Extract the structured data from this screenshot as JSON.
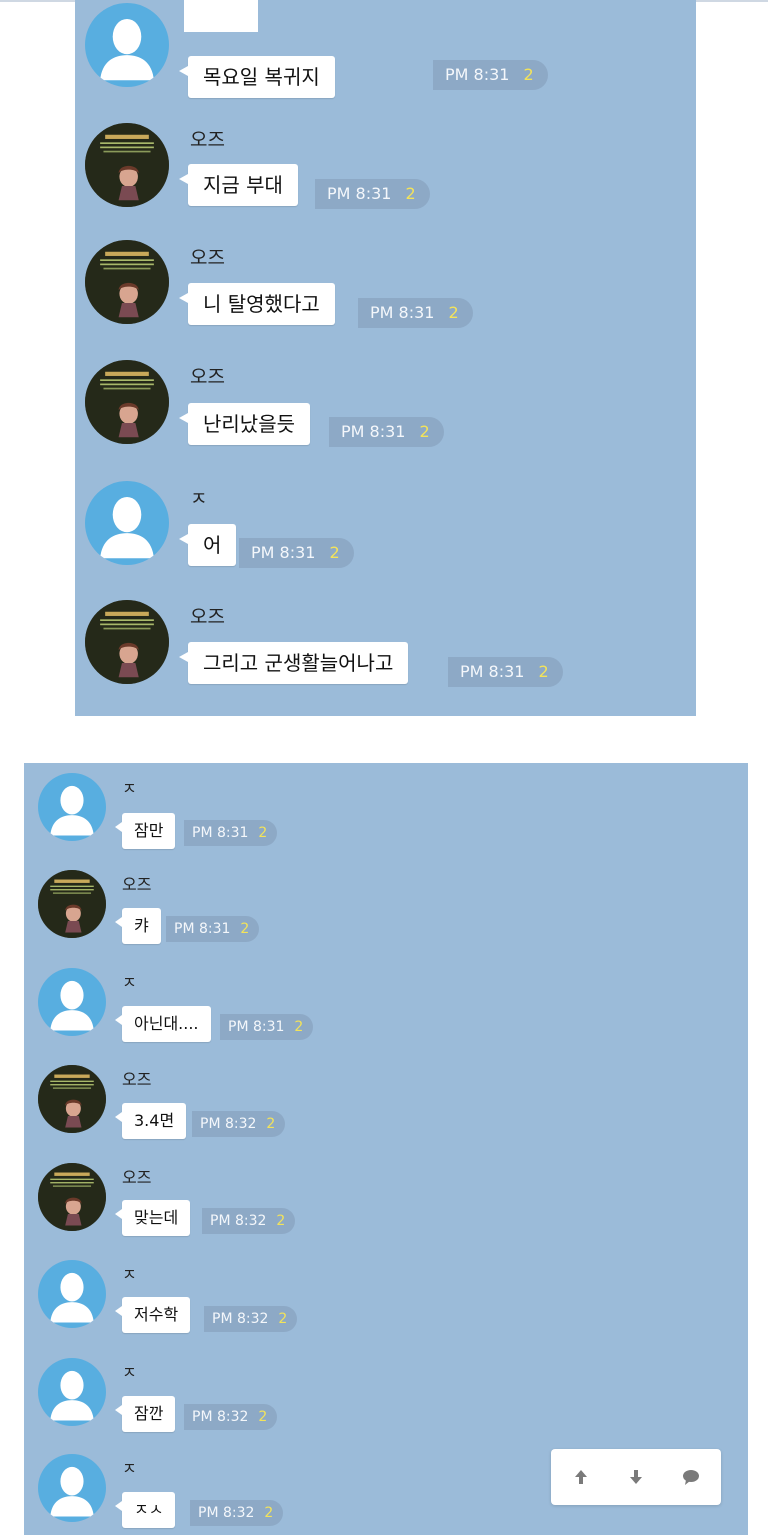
{
  "top_chat": {
    "messages": [
      {
        "avatar": "default-profile",
        "sender": "",
        "text": "목요일 복귀지",
        "time": "PM 8:31",
        "count": "2"
      },
      {
        "avatar": "oz-profile",
        "sender": "오즈",
        "text": "지금 부대",
        "time": "PM 8:31",
        "count": "2"
      },
      {
        "avatar": "oz-profile",
        "sender": "오즈",
        "text": "니 탈영했다고",
        "time": "PM 8:31",
        "count": "2"
      },
      {
        "avatar": "oz-profile",
        "sender": "오즈",
        "text": "난리났을듯",
        "time": "PM 8:31",
        "count": "2"
      },
      {
        "avatar": "default-profile",
        "sender": "ㅈ",
        "text": "어",
        "time": "PM 8:31",
        "count": "2"
      },
      {
        "avatar": "oz-profile",
        "sender": "오즈",
        "text": "그리고 군생활늘어나고",
        "time": "PM 8:31",
        "count": "2"
      }
    ]
  },
  "bottom_chat": {
    "messages": [
      {
        "avatar": "default-profile",
        "sender": "ㅈ",
        "text": "잠만",
        "time": "PM 8:31",
        "count": "2"
      },
      {
        "avatar": "oz-profile",
        "sender": "오즈",
        "text": "캬",
        "time": "PM 8:31",
        "count": "2"
      },
      {
        "avatar": "default-profile",
        "sender": "ㅈ",
        "text": "아닌대....",
        "time": "PM 8:31",
        "count": "2"
      },
      {
        "avatar": "oz-profile",
        "sender": "오즈",
        "text": "3.4면",
        "time": "PM 8:32",
        "count": "2"
      },
      {
        "avatar": "oz-profile",
        "sender": "오즈",
        "text": "맞는데",
        "time": "PM 8:32",
        "count": "2"
      },
      {
        "avatar": "default-profile",
        "sender": "ㅈ",
        "text": "저수학",
        "time": "PM 8:32",
        "count": "2"
      },
      {
        "avatar": "default-profile",
        "sender": "ㅈ",
        "text": "잠깐",
        "time": "PM 8:32",
        "count": "2"
      },
      {
        "avatar": "default-profile",
        "sender": "ㅈ",
        "text": "ㅈㅅ",
        "time": "PM 8:32",
        "count": "2"
      }
    ]
  },
  "nav_controls": {
    "icons": [
      "arrow-up-icon",
      "arrow-down-icon",
      "speech-bubble-icon"
    ]
  },
  "colors": {
    "chat_background": "#9bbbd9",
    "bubble": "#ffffff",
    "time_pill": "#8da9c6",
    "unread_count": "#f3e35a",
    "default_avatar_bg": "#58aee0"
  }
}
